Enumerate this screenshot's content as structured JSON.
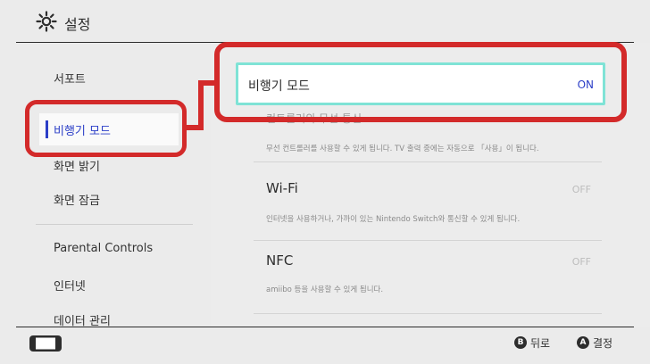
{
  "header": {
    "title": "설정",
    "icon": "gear-icon"
  },
  "sidebar": {
    "items": [
      {
        "label": "서포트"
      },
      {
        "label": "비행기 모드"
      },
      {
        "label": "화면 밝기"
      },
      {
        "label": "화면 잠금"
      },
      {
        "label": "Parental Controls"
      },
      {
        "label": "인터넷"
      },
      {
        "label": "데이터 관리"
      }
    ],
    "selected_index": 1
  },
  "main": {
    "airplane": {
      "label": "비행기 모드",
      "value": "ON"
    },
    "covered_text": "컨트롤러의 무선 통신",
    "controller_desc": "무선 컨트롤러를 사용할 수 있게 됩니다. TV 출력 중에는 자동으로 「사용」이 됩니다.",
    "wifi": {
      "label": "Wi-Fi",
      "value": "OFF",
      "desc": "인터넷을 사용하거나, 가까이 있는 Nintendo Switch와 통신할 수 있게 됩니다."
    },
    "nfc": {
      "label": "NFC",
      "value": "OFF",
      "desc": "amiibo 등을 사용할 수 있게 됩니다."
    }
  },
  "footer": {
    "back": {
      "button": "B",
      "label": "뒤로"
    },
    "confirm": {
      "button": "A",
      "label": "결정"
    },
    "icon": "switch-console-icon"
  },
  "colors": {
    "accent": "#2b3ec7",
    "highlight": "#7fe3d6",
    "callout": "#d32a2a",
    "background": "#ebebeb"
  }
}
